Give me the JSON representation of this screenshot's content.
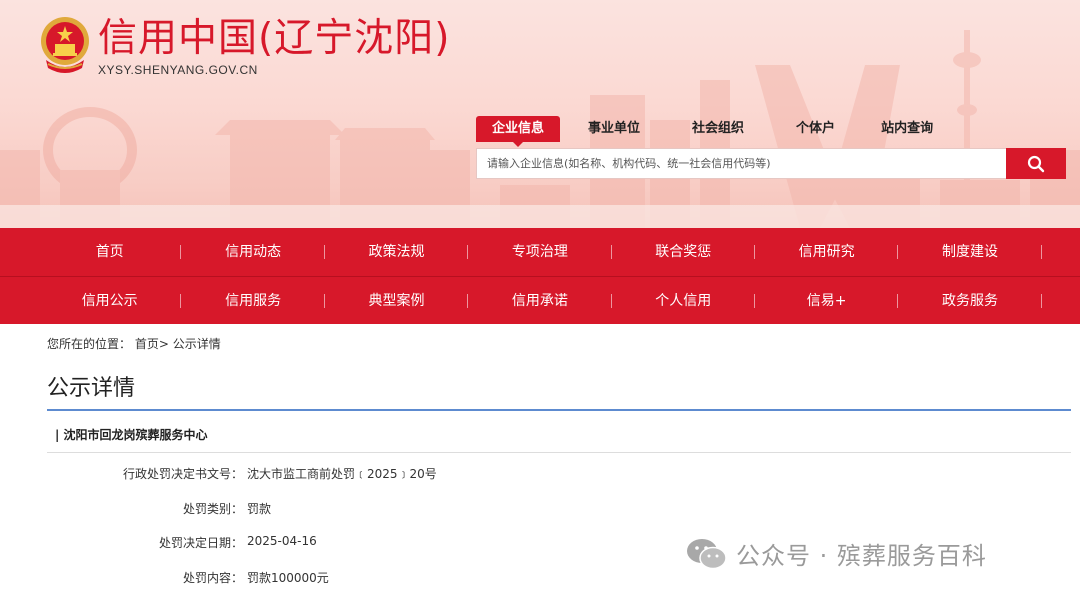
{
  "header": {
    "site_title": "信用中国(辽宁沈阳)",
    "site_domain": "XYSY.SHENYANG.GOV.CN",
    "emblem_icon": "national-emblem-icon"
  },
  "search": {
    "tabs": [
      {
        "label": "企业信息",
        "active": true
      },
      {
        "label": "事业单位",
        "active": false
      },
      {
        "label": "社会组织",
        "active": false
      },
      {
        "label": "个体户",
        "active": false
      },
      {
        "label": "站内查询",
        "active": false
      }
    ],
    "placeholder": "请输入企业信息(如名称、机构代码、统一社会信用代码等)",
    "button_icon": "search-icon"
  },
  "nav": {
    "row1": [
      "首页",
      "信用动态",
      "政策法规",
      "专项治理",
      "联合奖惩",
      "信用研究",
      "制度建设"
    ],
    "row2": [
      "信用公示",
      "信用服务",
      "典型案例",
      "信用承诺",
      "个人信用",
      "信易+",
      "政务服务"
    ]
  },
  "breadcrumb": {
    "prefix": "您所在的位置：",
    "home": "首页",
    "separator": ">",
    "current": "公示详情"
  },
  "page": {
    "title": "公示详情",
    "org_name": "| 沈阳市回龙岗殡葬服务中心",
    "fields": [
      {
        "label": "行政处罚决定书文号：",
        "value": "沈大市监工商前处罚﹝2025﹞20号"
      },
      {
        "label": "处罚类别：",
        "value": "罚款"
      },
      {
        "label": "处罚决定日期：",
        "value": "2025-04-16"
      },
      {
        "label": "处罚内容：",
        "value": "罚款100000元"
      }
    ]
  },
  "watermark": {
    "text": "公众号 · 殡葬服务百科",
    "icon": "wechat-icon"
  },
  "colors": {
    "brand_red": "#d7182a",
    "rule_blue": "#5d8bd0"
  }
}
